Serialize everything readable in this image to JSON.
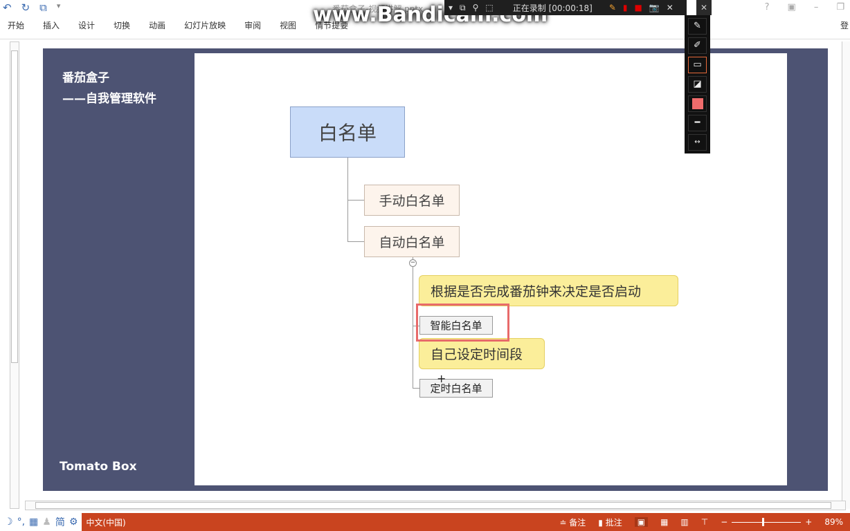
{
  "window": {
    "title": "番茄盒子-视频讲解.pptx",
    "login": "登"
  },
  "quick_access": {
    "undo": "↶",
    "redo": "↻",
    "present": "⧉",
    "more": "▾"
  },
  "menu": [
    "开始",
    "插入",
    "设计",
    "切换",
    "动画",
    "幻灯片放映",
    "审阅",
    "视图",
    "情节提要"
  ],
  "recorder": {
    "status": "正在录制 [00:00:18]",
    "watermark": "www.Bandicam.com"
  },
  "slide": {
    "title_line1": "番茄盒子",
    "title_line2": "——自我管理软件",
    "brand": "Tomato Box",
    "mindmap": {
      "root": "白名单",
      "child1": "手动白名单",
      "child2": "自动白名单",
      "leaf1": "智能白名单",
      "leaf2": "定时白名单",
      "callout1": "根据是否完成番茄钟来决定是否启动",
      "callout2": "自己设定时间段"
    }
  },
  "statusbar": {
    "ime_label": "简",
    "language": "中文(中国)",
    "notes": "备注",
    "comments": "批注",
    "zoom": "89%"
  },
  "colors": {
    "status": "#c9441f",
    "slide_bg": "#4d5373",
    "highlight": "#e86a6a"
  }
}
